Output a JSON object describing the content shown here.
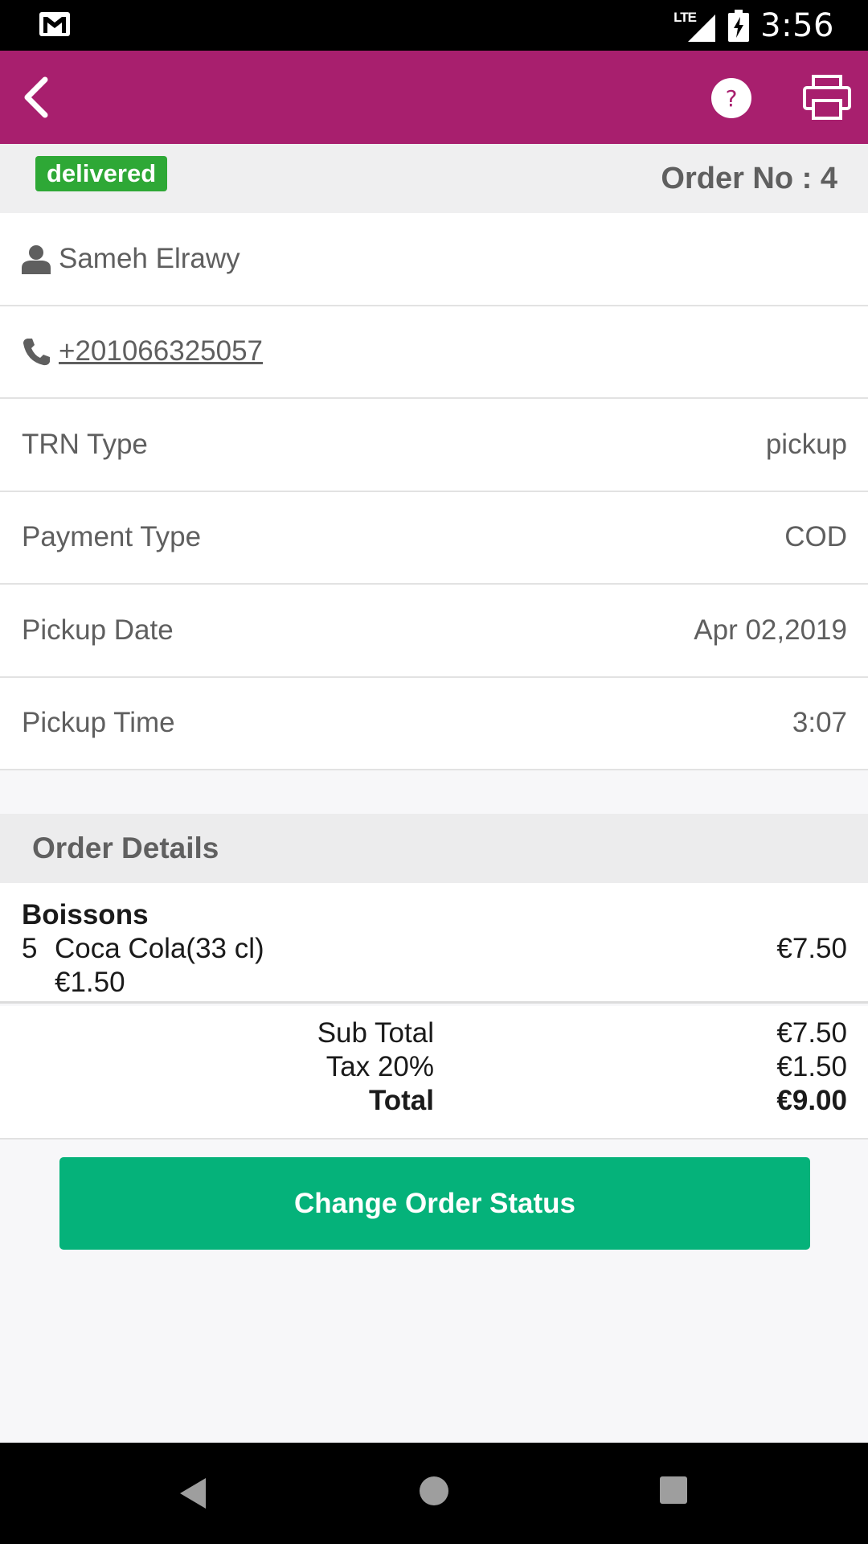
{
  "status_bar": {
    "time": "3:56",
    "network": "LTE"
  },
  "app_bar": {
    "back_icon": "chevron-left-icon",
    "help_icon": "question-circle-icon",
    "print_icon": "printer-icon",
    "color": "#a81f6e"
  },
  "order": {
    "status_badge": "delivered",
    "order_no_label": "Order No : 4"
  },
  "customer": {
    "name": "Sameh Elrawy",
    "phone": "+201066325057"
  },
  "info_rows": [
    {
      "label": "TRN Type",
      "value": "pickup"
    },
    {
      "label": "Payment Type",
      "value": "COD"
    },
    {
      "label": "Pickup Date",
      "value": "Apr 02,2019"
    },
    {
      "label": "Pickup Time",
      "value": "3:07"
    }
  ],
  "order_details": {
    "header": "Order Details",
    "category": "Boissons",
    "items": [
      {
        "qty": "5",
        "name": "Coca Cola(33 cl)",
        "unit_price": "€1.50",
        "line_total": "€7.50"
      }
    ]
  },
  "totals": {
    "sub_total_label": "Sub Total",
    "sub_total_value": "€7.50",
    "tax_label": "Tax 20%",
    "tax_value": "€1.50",
    "total_label": "Total",
    "total_value": "€9.00"
  },
  "actions": {
    "change_status_label": "Change Order Status",
    "button_color": "#05b27a"
  }
}
